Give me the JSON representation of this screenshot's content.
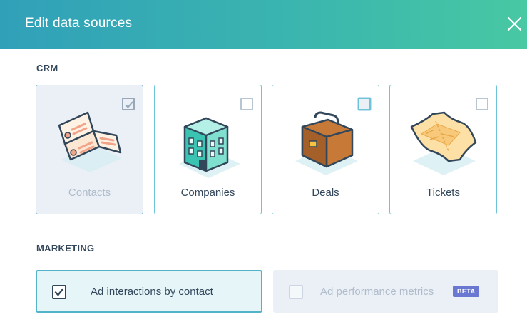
{
  "dialog": {
    "title": "Edit data sources"
  },
  "crm": {
    "label": "CRM",
    "cards": [
      {
        "label": "Contacts",
        "checked": true,
        "icon": "contact-cards-icon"
      },
      {
        "label": "Companies",
        "checked": false,
        "icon": "building-icon"
      },
      {
        "label": "Deals",
        "checked": false,
        "icon": "briefcase-icon"
      },
      {
        "label": "Tickets",
        "checked": false,
        "icon": "ticket-icon"
      }
    ]
  },
  "marketing": {
    "label": "MARKETING",
    "options": [
      {
        "label": "Ad interactions by contact",
        "checked": true
      },
      {
        "label": "Ad performance metrics",
        "checked": false,
        "disabled": true,
        "badge": "BETA"
      }
    ]
  },
  "colors": {
    "header_start": "#30a0b9",
    "header_end": "#48c8a3",
    "accent": "#52b3c9",
    "badge": "#6a78d1",
    "text": "#33475b"
  }
}
